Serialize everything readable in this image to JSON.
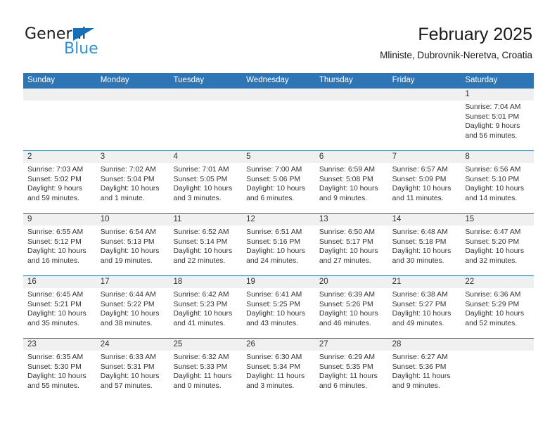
{
  "brand": {
    "name_top": "General",
    "name_bottom": "Blue",
    "accent_color": "#2b93d8",
    "triangle_color": "#1670b8"
  },
  "header": {
    "title": "February 2025",
    "subtitle": "Mliniste, Dubrovnik-Neretva, Croatia"
  },
  "theme": {
    "header_blue": "#2e75b6",
    "daynum_band": "#f0f0f0",
    "text": "#333333"
  },
  "weekdays": [
    "Sunday",
    "Monday",
    "Tuesday",
    "Wednesday",
    "Thursday",
    "Friday",
    "Saturday"
  ],
  "weeks": [
    [
      {
        "day": "",
        "sunrise": "",
        "sunset": "",
        "daylight": "",
        "empty": true
      },
      {
        "day": "",
        "sunrise": "",
        "sunset": "",
        "daylight": "",
        "empty": true
      },
      {
        "day": "",
        "sunrise": "",
        "sunset": "",
        "daylight": "",
        "empty": true
      },
      {
        "day": "",
        "sunrise": "",
        "sunset": "",
        "daylight": "",
        "empty": true
      },
      {
        "day": "",
        "sunrise": "",
        "sunset": "",
        "daylight": "",
        "empty": true
      },
      {
        "day": "",
        "sunrise": "",
        "sunset": "",
        "daylight": "",
        "empty": true
      },
      {
        "day": "1",
        "sunrise": "Sunrise: 7:04 AM",
        "sunset": "Sunset: 5:01 PM",
        "daylight": "Daylight: 9 hours and 56 minutes."
      }
    ],
    [
      {
        "day": "2",
        "sunrise": "Sunrise: 7:03 AM",
        "sunset": "Sunset: 5:02 PM",
        "daylight": "Daylight: 9 hours and 59 minutes."
      },
      {
        "day": "3",
        "sunrise": "Sunrise: 7:02 AM",
        "sunset": "Sunset: 5:04 PM",
        "daylight": "Daylight: 10 hours and 1 minute."
      },
      {
        "day": "4",
        "sunrise": "Sunrise: 7:01 AM",
        "sunset": "Sunset: 5:05 PM",
        "daylight": "Daylight: 10 hours and 3 minutes."
      },
      {
        "day": "5",
        "sunrise": "Sunrise: 7:00 AM",
        "sunset": "Sunset: 5:06 PM",
        "daylight": "Daylight: 10 hours and 6 minutes."
      },
      {
        "day": "6",
        "sunrise": "Sunrise: 6:59 AM",
        "sunset": "Sunset: 5:08 PM",
        "daylight": "Daylight: 10 hours and 9 minutes."
      },
      {
        "day": "7",
        "sunrise": "Sunrise: 6:57 AM",
        "sunset": "Sunset: 5:09 PM",
        "daylight": "Daylight: 10 hours and 11 minutes."
      },
      {
        "day": "8",
        "sunrise": "Sunrise: 6:56 AM",
        "sunset": "Sunset: 5:10 PM",
        "daylight": "Daylight: 10 hours and 14 minutes."
      }
    ],
    [
      {
        "day": "9",
        "sunrise": "Sunrise: 6:55 AM",
        "sunset": "Sunset: 5:12 PM",
        "daylight": "Daylight: 10 hours and 16 minutes."
      },
      {
        "day": "10",
        "sunrise": "Sunrise: 6:54 AM",
        "sunset": "Sunset: 5:13 PM",
        "daylight": "Daylight: 10 hours and 19 minutes."
      },
      {
        "day": "11",
        "sunrise": "Sunrise: 6:52 AM",
        "sunset": "Sunset: 5:14 PM",
        "daylight": "Daylight: 10 hours and 22 minutes."
      },
      {
        "day": "12",
        "sunrise": "Sunrise: 6:51 AM",
        "sunset": "Sunset: 5:16 PM",
        "daylight": "Daylight: 10 hours and 24 minutes."
      },
      {
        "day": "13",
        "sunrise": "Sunrise: 6:50 AM",
        "sunset": "Sunset: 5:17 PM",
        "daylight": "Daylight: 10 hours and 27 minutes."
      },
      {
        "day": "14",
        "sunrise": "Sunrise: 6:48 AM",
        "sunset": "Sunset: 5:18 PM",
        "daylight": "Daylight: 10 hours and 30 minutes."
      },
      {
        "day": "15",
        "sunrise": "Sunrise: 6:47 AM",
        "sunset": "Sunset: 5:20 PM",
        "daylight": "Daylight: 10 hours and 32 minutes."
      }
    ],
    [
      {
        "day": "16",
        "sunrise": "Sunrise: 6:45 AM",
        "sunset": "Sunset: 5:21 PM",
        "daylight": "Daylight: 10 hours and 35 minutes."
      },
      {
        "day": "17",
        "sunrise": "Sunrise: 6:44 AM",
        "sunset": "Sunset: 5:22 PM",
        "daylight": "Daylight: 10 hours and 38 minutes."
      },
      {
        "day": "18",
        "sunrise": "Sunrise: 6:42 AM",
        "sunset": "Sunset: 5:23 PM",
        "daylight": "Daylight: 10 hours and 41 minutes."
      },
      {
        "day": "19",
        "sunrise": "Sunrise: 6:41 AM",
        "sunset": "Sunset: 5:25 PM",
        "daylight": "Daylight: 10 hours and 43 minutes."
      },
      {
        "day": "20",
        "sunrise": "Sunrise: 6:39 AM",
        "sunset": "Sunset: 5:26 PM",
        "daylight": "Daylight: 10 hours and 46 minutes."
      },
      {
        "day": "21",
        "sunrise": "Sunrise: 6:38 AM",
        "sunset": "Sunset: 5:27 PM",
        "daylight": "Daylight: 10 hours and 49 minutes."
      },
      {
        "day": "22",
        "sunrise": "Sunrise: 6:36 AM",
        "sunset": "Sunset: 5:29 PM",
        "daylight": "Daylight: 10 hours and 52 minutes."
      }
    ],
    [
      {
        "day": "23",
        "sunrise": "Sunrise: 6:35 AM",
        "sunset": "Sunset: 5:30 PM",
        "daylight": "Daylight: 10 hours and 55 minutes."
      },
      {
        "day": "24",
        "sunrise": "Sunrise: 6:33 AM",
        "sunset": "Sunset: 5:31 PM",
        "daylight": "Daylight: 10 hours and 57 minutes."
      },
      {
        "day": "25",
        "sunrise": "Sunrise: 6:32 AM",
        "sunset": "Sunset: 5:33 PM",
        "daylight": "Daylight: 11 hours and 0 minutes."
      },
      {
        "day": "26",
        "sunrise": "Sunrise: 6:30 AM",
        "sunset": "Sunset: 5:34 PM",
        "daylight": "Daylight: 11 hours and 3 minutes."
      },
      {
        "day": "27",
        "sunrise": "Sunrise: 6:29 AM",
        "sunset": "Sunset: 5:35 PM",
        "daylight": "Daylight: 11 hours and 6 minutes."
      },
      {
        "day": "28",
        "sunrise": "Sunrise: 6:27 AM",
        "sunset": "Sunset: 5:36 PM",
        "daylight": "Daylight: 11 hours and 9 minutes."
      },
      {
        "day": "",
        "sunrise": "",
        "sunset": "",
        "daylight": "",
        "empty": true
      }
    ]
  ]
}
